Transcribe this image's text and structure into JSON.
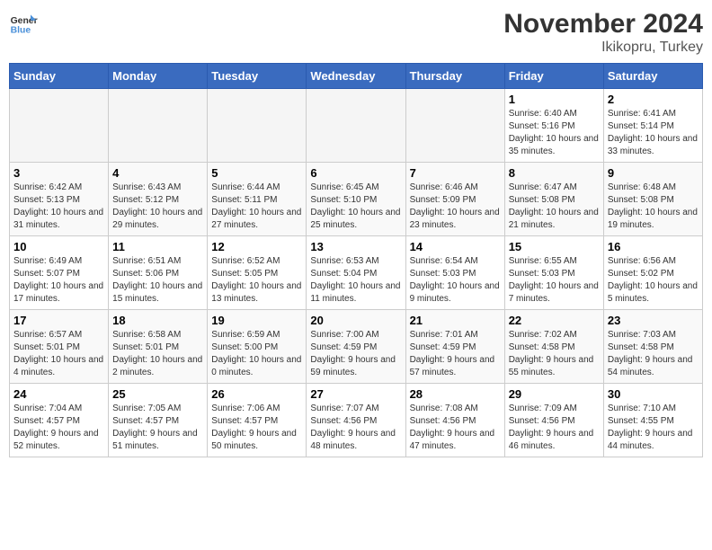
{
  "header": {
    "logo_general": "General",
    "logo_blue": "Blue",
    "month_year": "November 2024",
    "location": "Ikikopru, Turkey"
  },
  "weekdays": [
    "Sunday",
    "Monday",
    "Tuesday",
    "Wednesday",
    "Thursday",
    "Friday",
    "Saturday"
  ],
  "weeks": [
    [
      {
        "day": "",
        "empty": true
      },
      {
        "day": "",
        "empty": true
      },
      {
        "day": "",
        "empty": true
      },
      {
        "day": "",
        "empty": true
      },
      {
        "day": "",
        "empty": true
      },
      {
        "day": "1",
        "sunrise": "Sunrise: 6:40 AM",
        "sunset": "Sunset: 5:16 PM",
        "daylight": "Daylight: 10 hours and 35 minutes."
      },
      {
        "day": "2",
        "sunrise": "Sunrise: 6:41 AM",
        "sunset": "Sunset: 5:14 PM",
        "daylight": "Daylight: 10 hours and 33 minutes."
      }
    ],
    [
      {
        "day": "3",
        "sunrise": "Sunrise: 6:42 AM",
        "sunset": "Sunset: 5:13 PM",
        "daylight": "Daylight: 10 hours and 31 minutes."
      },
      {
        "day": "4",
        "sunrise": "Sunrise: 6:43 AM",
        "sunset": "Sunset: 5:12 PM",
        "daylight": "Daylight: 10 hours and 29 minutes."
      },
      {
        "day": "5",
        "sunrise": "Sunrise: 6:44 AM",
        "sunset": "Sunset: 5:11 PM",
        "daylight": "Daylight: 10 hours and 27 minutes."
      },
      {
        "day": "6",
        "sunrise": "Sunrise: 6:45 AM",
        "sunset": "Sunset: 5:10 PM",
        "daylight": "Daylight: 10 hours and 25 minutes."
      },
      {
        "day": "7",
        "sunrise": "Sunrise: 6:46 AM",
        "sunset": "Sunset: 5:09 PM",
        "daylight": "Daylight: 10 hours and 23 minutes."
      },
      {
        "day": "8",
        "sunrise": "Sunrise: 6:47 AM",
        "sunset": "Sunset: 5:08 PM",
        "daylight": "Daylight: 10 hours and 21 minutes."
      },
      {
        "day": "9",
        "sunrise": "Sunrise: 6:48 AM",
        "sunset": "Sunset: 5:08 PM",
        "daylight": "Daylight: 10 hours and 19 minutes."
      }
    ],
    [
      {
        "day": "10",
        "sunrise": "Sunrise: 6:49 AM",
        "sunset": "Sunset: 5:07 PM",
        "daylight": "Daylight: 10 hours and 17 minutes."
      },
      {
        "day": "11",
        "sunrise": "Sunrise: 6:51 AM",
        "sunset": "Sunset: 5:06 PM",
        "daylight": "Daylight: 10 hours and 15 minutes."
      },
      {
        "day": "12",
        "sunrise": "Sunrise: 6:52 AM",
        "sunset": "Sunset: 5:05 PM",
        "daylight": "Daylight: 10 hours and 13 minutes."
      },
      {
        "day": "13",
        "sunrise": "Sunrise: 6:53 AM",
        "sunset": "Sunset: 5:04 PM",
        "daylight": "Daylight: 10 hours and 11 minutes."
      },
      {
        "day": "14",
        "sunrise": "Sunrise: 6:54 AM",
        "sunset": "Sunset: 5:03 PM",
        "daylight": "Daylight: 10 hours and 9 minutes."
      },
      {
        "day": "15",
        "sunrise": "Sunrise: 6:55 AM",
        "sunset": "Sunset: 5:03 PM",
        "daylight": "Daylight: 10 hours and 7 minutes."
      },
      {
        "day": "16",
        "sunrise": "Sunrise: 6:56 AM",
        "sunset": "Sunset: 5:02 PM",
        "daylight": "Daylight: 10 hours and 5 minutes."
      }
    ],
    [
      {
        "day": "17",
        "sunrise": "Sunrise: 6:57 AM",
        "sunset": "Sunset: 5:01 PM",
        "daylight": "Daylight: 10 hours and 4 minutes."
      },
      {
        "day": "18",
        "sunrise": "Sunrise: 6:58 AM",
        "sunset": "Sunset: 5:01 PM",
        "daylight": "Daylight: 10 hours and 2 minutes."
      },
      {
        "day": "19",
        "sunrise": "Sunrise: 6:59 AM",
        "sunset": "Sunset: 5:00 PM",
        "daylight": "Daylight: 10 hours and 0 minutes."
      },
      {
        "day": "20",
        "sunrise": "Sunrise: 7:00 AM",
        "sunset": "Sunset: 4:59 PM",
        "daylight": "Daylight: 9 hours and 59 minutes."
      },
      {
        "day": "21",
        "sunrise": "Sunrise: 7:01 AM",
        "sunset": "Sunset: 4:59 PM",
        "daylight": "Daylight: 9 hours and 57 minutes."
      },
      {
        "day": "22",
        "sunrise": "Sunrise: 7:02 AM",
        "sunset": "Sunset: 4:58 PM",
        "daylight": "Daylight: 9 hours and 55 minutes."
      },
      {
        "day": "23",
        "sunrise": "Sunrise: 7:03 AM",
        "sunset": "Sunset: 4:58 PM",
        "daylight": "Daylight: 9 hours and 54 minutes."
      }
    ],
    [
      {
        "day": "24",
        "sunrise": "Sunrise: 7:04 AM",
        "sunset": "Sunset: 4:57 PM",
        "daylight": "Daylight: 9 hours and 52 minutes."
      },
      {
        "day": "25",
        "sunrise": "Sunrise: 7:05 AM",
        "sunset": "Sunset: 4:57 PM",
        "daylight": "Daylight: 9 hours and 51 minutes."
      },
      {
        "day": "26",
        "sunrise": "Sunrise: 7:06 AM",
        "sunset": "Sunset: 4:57 PM",
        "daylight": "Daylight: 9 hours and 50 minutes."
      },
      {
        "day": "27",
        "sunrise": "Sunrise: 7:07 AM",
        "sunset": "Sunset: 4:56 PM",
        "daylight": "Daylight: 9 hours and 48 minutes."
      },
      {
        "day": "28",
        "sunrise": "Sunrise: 7:08 AM",
        "sunset": "Sunset: 4:56 PM",
        "daylight": "Daylight: 9 hours and 47 minutes."
      },
      {
        "day": "29",
        "sunrise": "Sunrise: 7:09 AM",
        "sunset": "Sunset: 4:56 PM",
        "daylight": "Daylight: 9 hours and 46 minutes."
      },
      {
        "day": "30",
        "sunrise": "Sunrise: 7:10 AM",
        "sunset": "Sunset: 4:55 PM",
        "daylight": "Daylight: 9 hours and 44 minutes."
      }
    ]
  ]
}
